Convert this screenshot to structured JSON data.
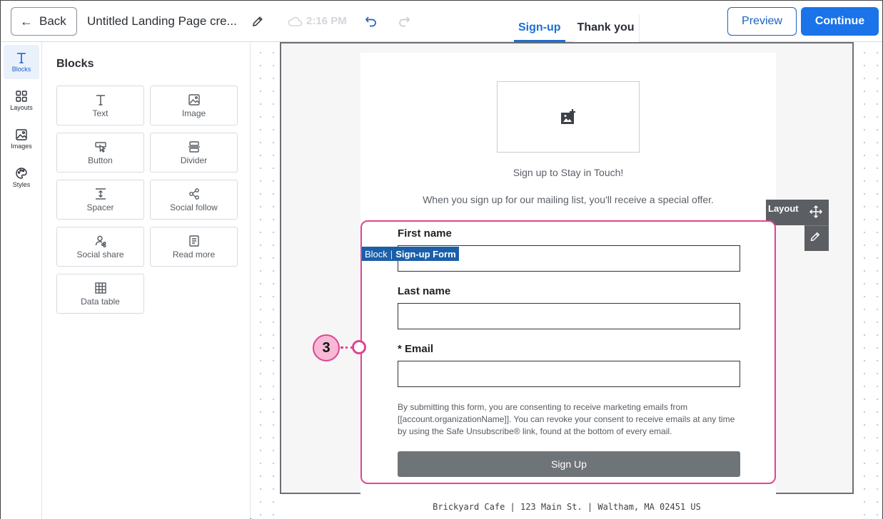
{
  "header": {
    "back_label": "Back",
    "doc_title": "Untitled Landing Page cre...",
    "save_time": "2:16 PM",
    "tabs": [
      {
        "label": "Sign-up",
        "active": true
      },
      {
        "label": "Thank you",
        "active": false
      }
    ],
    "preview_label": "Preview",
    "continue_label": "Continue"
  },
  "rail": {
    "items": [
      {
        "label": "Blocks",
        "icon": "text-t-icon",
        "active": true
      },
      {
        "label": "Layouts",
        "icon": "grid-icon"
      },
      {
        "label": "Images",
        "icon": "image-icon"
      },
      {
        "label": "Styles",
        "icon": "palette-icon"
      }
    ]
  },
  "panel": {
    "title": "Blocks",
    "blocks": [
      {
        "label": "Text",
        "icon": "text-t-icon"
      },
      {
        "label": "Image",
        "icon": "image-icon"
      },
      {
        "label": "Button",
        "icon": "button-cursor-icon"
      },
      {
        "label": "Divider",
        "icon": "divider-icon"
      },
      {
        "label": "Spacer",
        "icon": "spacer-icon"
      },
      {
        "label": "Social follow",
        "icon": "share-nodes-icon"
      },
      {
        "label": "Social share",
        "icon": "user-share-icon"
      },
      {
        "label": "Read more",
        "icon": "document-icon"
      },
      {
        "label": "Data table",
        "icon": "table-icon"
      }
    ]
  },
  "canvas": {
    "headline": "Sign up to Stay in Touch!",
    "subtext": "When you sign up for our mailing list, you'll receive a special offer.",
    "block_label_prefix": "Block",
    "block_label_name": "Sign-up Form",
    "layout_label": "Layout",
    "form": {
      "first_name_label": "First name",
      "last_name_label": "Last name",
      "email_label": "* Email",
      "consent": "By submitting this form, you are consenting to receive marketing emails from [[account.organizationName]]. You can revoke your consent to receive emails at any time by using the Safe Unsubscribe® link, found at the bottom of every email.",
      "submit_label": "Sign Up"
    },
    "footer": "Brickyard Cafe | 123 Main St. | Waltham, MA 02451 US"
  },
  "callout": {
    "number": "3"
  },
  "colors": {
    "accent": "#1a73e8",
    "highlight": "#e0448f",
    "block_label_bg": "#1b5fa8",
    "signup_button": "#6f7479"
  }
}
